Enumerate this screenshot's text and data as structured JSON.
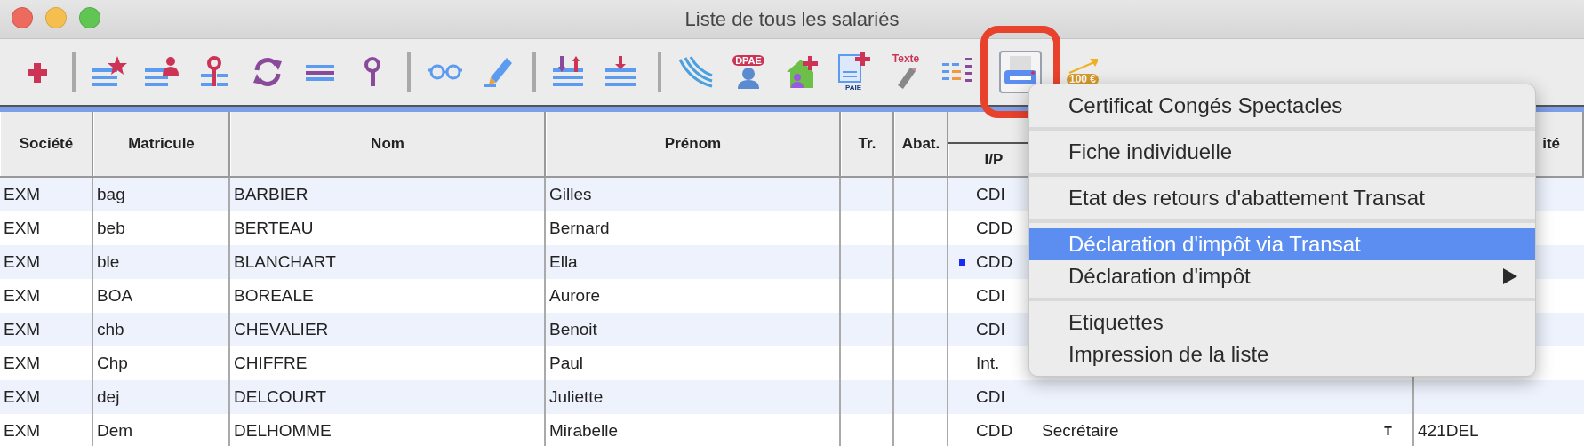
{
  "window": {
    "title": "Liste de tous les salariés"
  },
  "toolbar": [
    {
      "kind": "add",
      "highlighted": false
    },
    {
      "kind": "separator"
    },
    {
      "kind": "list-star",
      "highlighted": false
    },
    {
      "kind": "list-person",
      "highlighted": false
    },
    {
      "kind": "list-ring",
      "highlighted": false
    },
    {
      "kind": "refresh",
      "highlighted": false
    },
    {
      "kind": "equals",
      "highlighted": false
    },
    {
      "kind": "pin",
      "highlighted": false
    },
    {
      "kind": "separator"
    },
    {
      "kind": "glasses",
      "highlighted": false
    },
    {
      "kind": "pencil",
      "highlighted": false
    },
    {
      "kind": "separator"
    },
    {
      "kind": "sort",
      "highlighted": false
    },
    {
      "kind": "list-down",
      "highlighted": false
    },
    {
      "kind": "separator"
    },
    {
      "kind": "waves",
      "highlighted": false
    },
    {
      "kind": "person-badge",
      "label": "DPAE",
      "highlighted": false
    },
    {
      "kind": "house-add",
      "highlighted": false
    },
    {
      "kind": "document-add",
      "label": "PAIE",
      "highlighted": false
    },
    {
      "kind": "text-pen",
      "label": "Texte",
      "highlighted": false
    },
    {
      "kind": "bars",
      "highlighted": false
    },
    {
      "kind": "printer",
      "highlighted": true
    },
    {
      "kind": "money",
      "label": "100 €",
      "highlighted": false
    }
  ],
  "table": {
    "columns": [
      "Société",
      "Matricule",
      "Nom",
      "Prénom",
      "Tr.",
      "Abat.",
      "I/P",
      "ité"
    ],
    "rows": [
      {
        "societe": "EXM",
        "matricule": "bag",
        "nom": "BARBIER",
        "prenom": "Gilles",
        "contrat": "CDI",
        "marked": false
      },
      {
        "societe": "EXM",
        "matricule": "beb",
        "nom": "BERTEAU",
        "prenom": "Bernard",
        "contrat": "CDD",
        "marked": false
      },
      {
        "societe": "EXM",
        "matricule": "ble",
        "nom": "BLANCHART",
        "prenom": "Ella",
        "contrat": "CDD",
        "marked": true
      },
      {
        "societe": "EXM",
        "matricule": "BOA",
        "nom": "BOREALE",
        "prenom": "Aurore",
        "contrat": "CDI",
        "marked": false
      },
      {
        "societe": "EXM",
        "matricule": "chb",
        "nom": "CHEVALIER",
        "prenom": "Benoit",
        "contrat": "CDI",
        "marked": false
      },
      {
        "societe": "EXM",
        "matricule": "Chp",
        "nom": "CHIFFRE",
        "prenom": "Paul",
        "contrat": "Int.",
        "marked": false
      },
      {
        "societe": "EXM",
        "matricule": "dej",
        "nom": "DELCOURT",
        "prenom": "Juliette",
        "contrat": "CDI",
        "marked": false
      },
      {
        "societe": "EXM",
        "matricule": "Dem",
        "nom": "DELHOMME",
        "prenom": "Mirabelle",
        "contrat": "CDD",
        "marked": false,
        "fonction": "Secrétaire",
        "t": "T",
        "code": "421DEL"
      }
    ]
  },
  "menu": {
    "groups": [
      [
        {
          "label": "Certificat Congés Spectacles",
          "selected": false,
          "submenu": false
        }
      ],
      [
        {
          "label": "Fiche individuelle",
          "selected": false,
          "submenu": false
        }
      ],
      [
        {
          "label": "Etat des retours d'abattement Transat",
          "selected": false,
          "submenu": false
        }
      ],
      [
        {
          "label": "Déclaration d'impôt via Transat",
          "selected": true,
          "submenu": false
        },
        {
          "label": "Déclaration d'impôt",
          "selected": false,
          "submenu": true
        }
      ],
      [
        {
          "label": "Etiquettes",
          "selected": false,
          "submenu": false
        },
        {
          "label": "Impression de la liste",
          "selected": false,
          "submenu": false
        }
      ]
    ]
  }
}
